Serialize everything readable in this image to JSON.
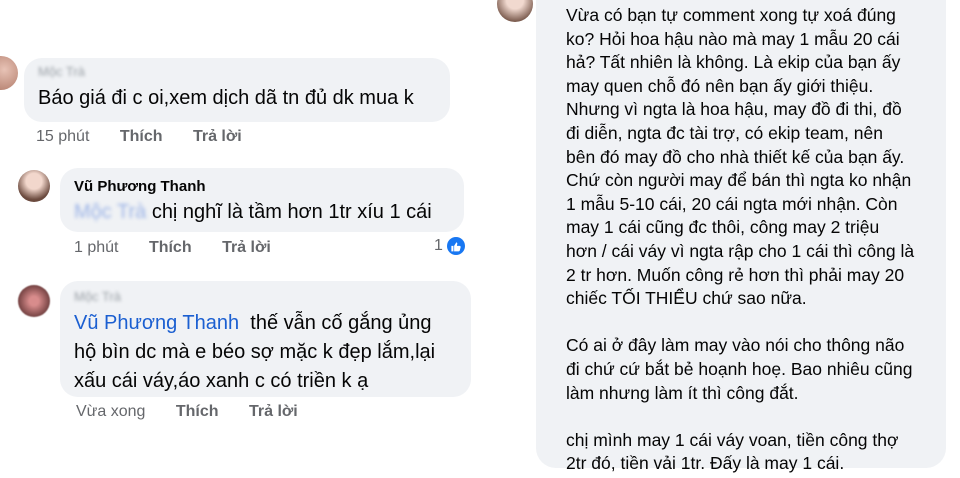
{
  "comments": [
    {
      "author": "Mộc Trà",
      "text": "Báo giá đi c oi,xem dịch dã tn đủ dk mua k",
      "time": "15 phút",
      "like_label": "Thích",
      "reply_label": "Trả lời"
    },
    {
      "author": "Vũ Phương Thanh",
      "mention": "Mộc Trà",
      "text": "chị nghĩ là tầm hơn 1tr xíu 1 cái",
      "time": "1 phút",
      "like_label": "Thích",
      "reply_label": "Trả lời",
      "reaction_count": "1"
    },
    {
      "author": "Mộc Trà",
      "mention": "Vũ Phương Thanh",
      "text_line1": "thế vẫn cố gắng ủng",
      "text_line2": "hộ bìn dc mà e béo sợ mặc k đẹp lắm,lại",
      "text_line3": "xấu cái váy,áo xanh c có triền k ạ",
      "time": "Vừa xong",
      "like_label": "Thích",
      "reply_label": "Trả lời"
    }
  ],
  "post": {
    "paragraph1": [
      "Vừa có bạn tự comment xong tự xoá đúng",
      "ko? Hỏi hoa hậu nào mà may 1 mẫu 20 cái",
      "hả? Tất nhiên là không. Là ekip của bạn ấy",
      "may quen chỗ đó nên bạn ấy giới thiệu.",
      "Nhưng vì ngta là hoa hậu, may đồ đi thi, đồ",
      "đi diễn, ngta đc tài trợ, có ekip team, nên",
      "bên đó may đồ cho nhà thiết kế của bạn ấy.",
      "Chứ còn người may để bán thì ngta ko nhận",
      "1 mẫu 5-10 cái, 20 cái ngta mới nhận. Còn",
      "may 1 cái cũng đc thôi, công may 2 triệu",
      "hơn / cái váy vì ngta rập cho 1 cái thì công là",
      "2 tr hơn. Muốn công rẻ hơn thì phải may 20",
      "chiếc TỐI THIỂU chứ sao nữa."
    ],
    "paragraph2": [
      "Có ai ở đây làm may vào nói cho thông não",
      "đi chứ cứ bắt bẻ hoạnh hoẹ. Bao nhiêu cũng",
      "làm nhưng làm ít thì công đắt."
    ],
    "paragraph3": [
      "chị mình may 1 cái váy voan, tiền công thợ",
      "2tr đó, tiền vải 1tr. Đấy là may 1 cái."
    ]
  },
  "colors": {
    "bubble": "#f0f2f5",
    "mention": "#1b5fd1",
    "like_blue": "#1877f2",
    "meta": "#65676b"
  }
}
